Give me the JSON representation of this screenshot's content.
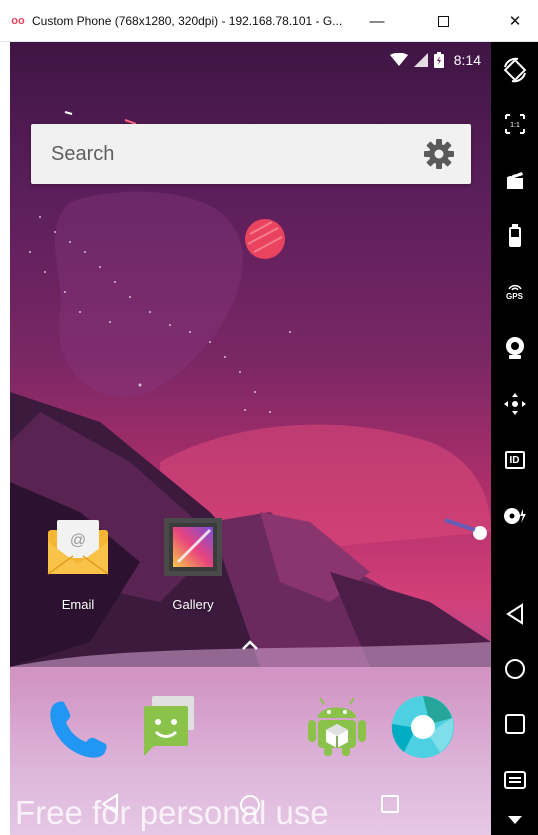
{
  "window": {
    "title": "Custom Phone (768x1280, 320dpi) - 192.168.78.101 - G...",
    "minimize_glyph": "—",
    "close_glyph": "✕"
  },
  "status": {
    "time": "8:14"
  },
  "search": {
    "placeholder": "Search"
  },
  "apps": [
    {
      "label": "Email",
      "icon": "email-icon"
    },
    {
      "label": "Gallery",
      "icon": "gallery-icon"
    }
  ],
  "dock": [
    "phone-icon",
    "messaging-icon",
    "android-icon",
    "camera-icon"
  ],
  "watermark": "Free for personal use",
  "toolbar": {
    "gps_label": "GPS",
    "id_label": "ID",
    "scale_label": "1:1"
  },
  "colors": {
    "accent": "#e8435a",
    "toolbar_bg": "#000000",
    "search_bg": "#f1f1f1"
  }
}
